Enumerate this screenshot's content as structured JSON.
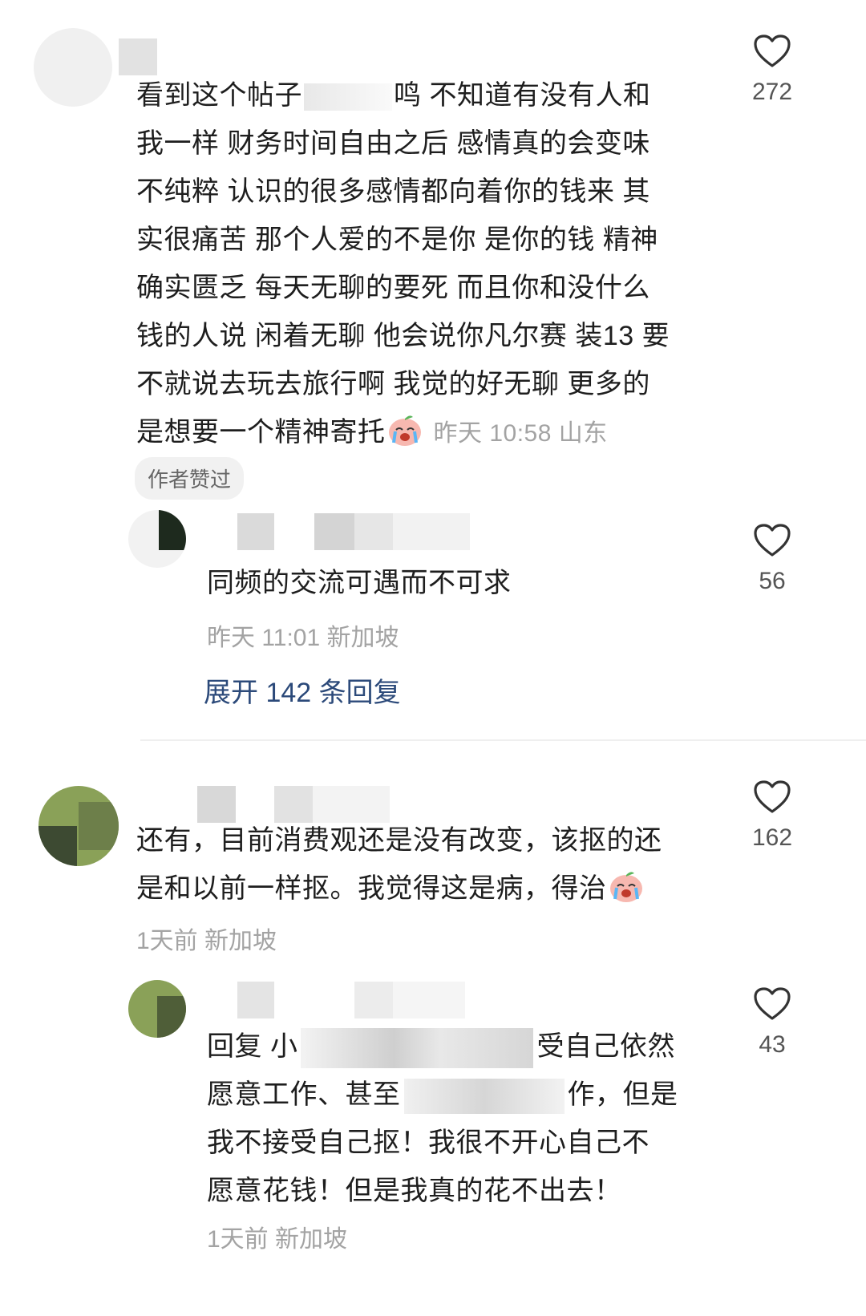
{
  "comments": [
    {
      "text_lines": [
        "看到这个帖子",
        "鸣 不知道有没有人和",
        "我一样 财务时间自由之后 感情真的会变味",
        "不纯粹 认识的很多感情都向着你的钱来 其",
        "实很痛苦 那个人爱的不是你 是你的钱 精神",
        "确实匮乏 每天无聊的要死 而且你和没什么",
        "钱的人说 闲着无聊 他会说你凡尔赛 装13 要",
        "不就说去玩去旅行啊 我觉的好无聊 更多的",
        "是想要一个精神寄托"
      ],
      "emoji": "crying-face-emoji",
      "time": "昨天 10:58",
      "location": "山东",
      "likes": "272",
      "badge": "作者赞过",
      "reply": {
        "text": "同频的交流可遇而不可求",
        "time": "昨天 11:01",
        "location": "新加坡",
        "likes": "56"
      },
      "expand_label": "展开 142 条回复"
    },
    {
      "text_lines": [
        "还有，目前消费观还是没有改变，该抠的还",
        "是和以前一样抠。我觉得这是病，得治"
      ],
      "emoji": "crying-face-emoji",
      "time": "1天前",
      "location": "新加坡",
      "likes": "162",
      "reply": {
        "text_lines": [
          "回复 小",
          "受自己依然",
          "愿意工作、甚至",
          "作，但是",
          "我不接受自己抠！我很不开心自己不",
          "愿意花钱！但是我真的花不出去！"
        ],
        "time": "1天前",
        "location": "新加坡",
        "likes": "43"
      }
    }
  ],
  "icons": {
    "like": "heart-outline-icon"
  },
  "colors": {
    "text": "#1e1e1e",
    "meta": "#a3a3a3",
    "link": "#2c4a7a",
    "badge_bg": "#f1f1f1"
  }
}
